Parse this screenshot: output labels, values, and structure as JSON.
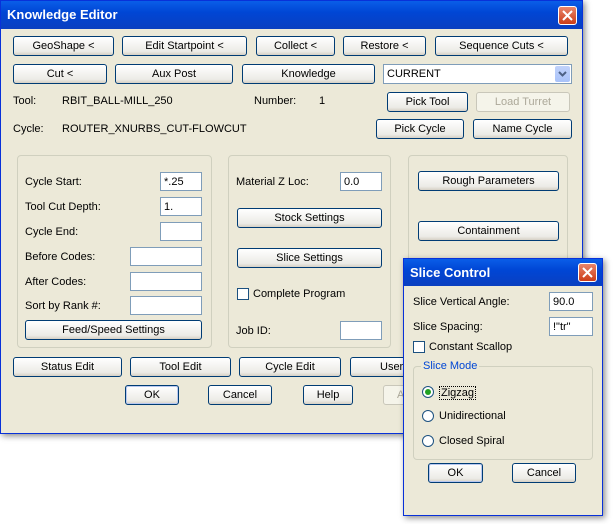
{
  "main_window": {
    "title": "Knowledge Editor",
    "row1_buttons": [
      "GeoShape <",
      "Edit Startpoint <",
      "Collect <",
      "Restore <",
      "Sequence Cuts <"
    ],
    "row2_buttons": [
      "Cut <",
      "Aux Post",
      "Knowledge"
    ],
    "combo_value": "CURRENT",
    "tool_label": "Tool:",
    "tool_value": "RBIT_BALL-MILL_250",
    "number_label": "Number:",
    "number_value": "1",
    "pick_tool": "Pick Tool",
    "load_turret": "Load Turret",
    "cycle_label": "Cycle:",
    "cycle_value": "ROUTER_XNURBS_CUT-FLOWCUT",
    "pick_cycle": "Pick Cycle",
    "name_cycle": "Name Cycle",
    "left_group": {
      "cycle_start_label": "Cycle Start:",
      "cycle_start_value": "*.25",
      "tool_cut_depth_label": "Tool Cut Depth:",
      "tool_cut_depth_value": "1.",
      "cycle_end_label": "Cycle End:",
      "cycle_end_value": "",
      "before_codes_label": "Before Codes:",
      "before_codes_value": "",
      "after_codes_label": "After Codes:",
      "after_codes_value": "",
      "sort_rank_label": "Sort by Rank #:",
      "sort_rank_value": "",
      "feed_speed_button": "Feed/Speed Settings"
    },
    "mid_group": {
      "material_z_label": "Material Z Loc:",
      "material_z_value": "0.0",
      "stock_settings": "Stock Settings",
      "slice_settings": "Slice Settings",
      "complete_program": "Complete Program",
      "job_id_label": "Job ID:",
      "job_id_value": ""
    },
    "right_group": {
      "rough_parameters": "Rough Parameters",
      "containment": "Containment"
    },
    "bottom_buttons": [
      "Status Edit",
      "Tool Edit",
      "Cycle Edit",
      "User"
    ],
    "ok": "OK",
    "cancel": "Cancel",
    "help": "Help",
    "apply_partial": "A"
  },
  "slice_window": {
    "title": "Slice Control",
    "vertical_angle_label": "Slice Vertical Angle:",
    "vertical_angle_value": "90.0",
    "spacing_label": "Slice Spacing:",
    "spacing_value": "!\"tr\"",
    "constant_scallop": "Constant Scallop",
    "mode_legend": "Slice Mode",
    "modes": [
      "Zigzag",
      "Unidirectional",
      "Closed Spiral"
    ],
    "selected_mode": "Zigzag",
    "ok": "OK",
    "cancel": "Cancel"
  },
  "colors": {
    "titlebar": "#0046d5",
    "dialog_bg": "#ece9d8",
    "close_red": "#cd3d18",
    "group_legend": "#0046d5"
  }
}
